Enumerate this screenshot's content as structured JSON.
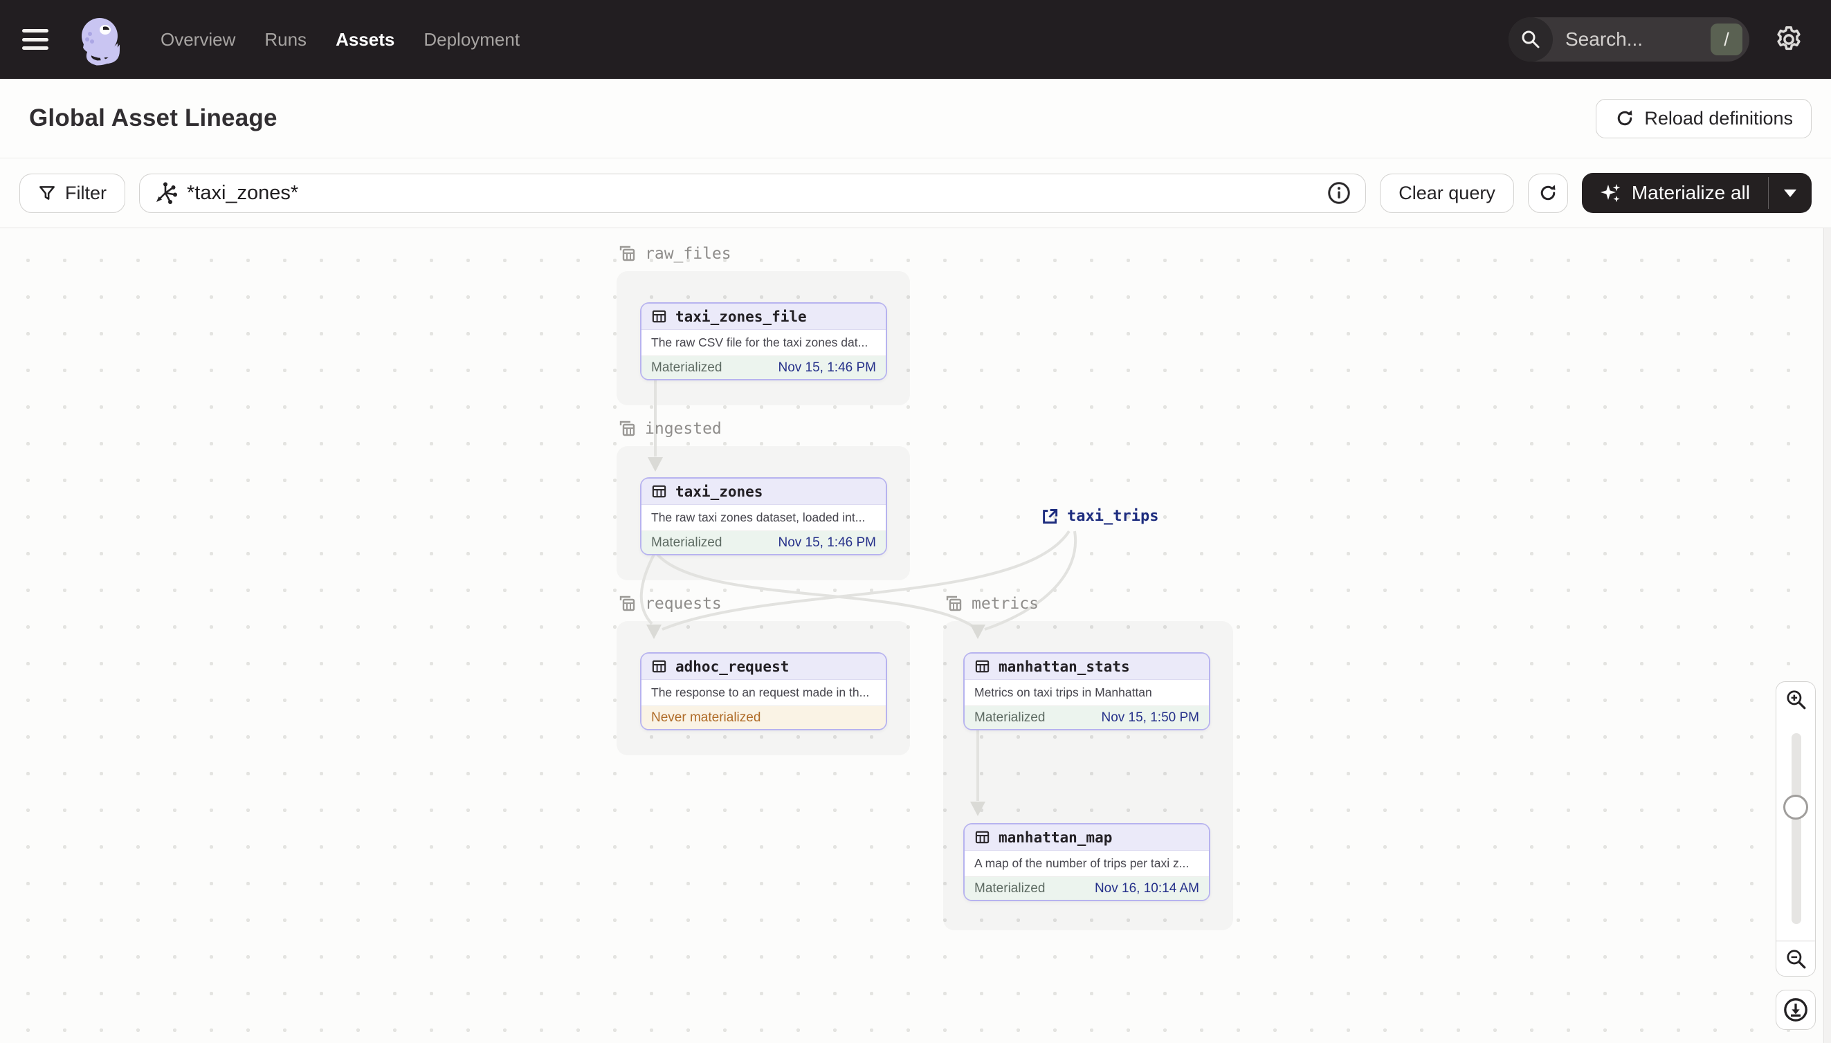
{
  "nav": {
    "items": [
      {
        "label": "Overview",
        "active": false
      },
      {
        "label": "Runs",
        "active": false
      },
      {
        "label": "Assets",
        "active": true
      },
      {
        "label": "Deployment",
        "active": false
      }
    ],
    "search_placeholder": "Search...",
    "search_shortcut": "/"
  },
  "header": {
    "title": "Global Asset Lineage",
    "reload_label": "Reload definitions"
  },
  "toolbar": {
    "filter_label": "Filter",
    "query_value": "*taxi_zones*",
    "clear_label": "Clear query",
    "materialize_label": "Materialize all"
  },
  "graph": {
    "groups": [
      {
        "name": "raw_files"
      },
      {
        "name": "ingested"
      },
      {
        "name": "requests"
      },
      {
        "name": "metrics"
      }
    ],
    "nodes": [
      {
        "name": "taxi_zones_file",
        "description": "The raw CSV file for the taxi zones dat...",
        "status": "Materialized",
        "timestamp": "Nov 15, 1:46 PM"
      },
      {
        "name": "taxi_zones",
        "description": "The raw taxi zones dataset, loaded int...",
        "status": "Materialized",
        "timestamp": "Nov 15, 1:46 PM"
      },
      {
        "name": "adhoc_request",
        "description": "The response to an request made in th...",
        "status": "Never materialized",
        "timestamp": ""
      },
      {
        "name": "manhattan_stats",
        "description": "Metrics on taxi trips in Manhattan",
        "status": "Materialized",
        "timestamp": "Nov 15, 1:50 PM"
      },
      {
        "name": "manhattan_map",
        "description": "A map of the number of trips per taxi z...",
        "status": "Materialized",
        "timestamp": "Nov 16, 10:14 AM"
      }
    ],
    "external_nodes": [
      {
        "name": "taxi_trips"
      }
    ]
  },
  "colors": {
    "topnav_bg": "#221E21",
    "logo_lavender": "#C9C5F2",
    "node_border": "#B7B3EF",
    "node_header_bg": "#EBEAF9",
    "materialized_bg": "#ECF4EE",
    "materialized_time": "#25308A",
    "never_materialized_text": "#AF6B27",
    "never_materialized_bg": "#FAF3E5",
    "edge_gray": "#E2E2DF",
    "dark_button_bg": "#242021"
  }
}
